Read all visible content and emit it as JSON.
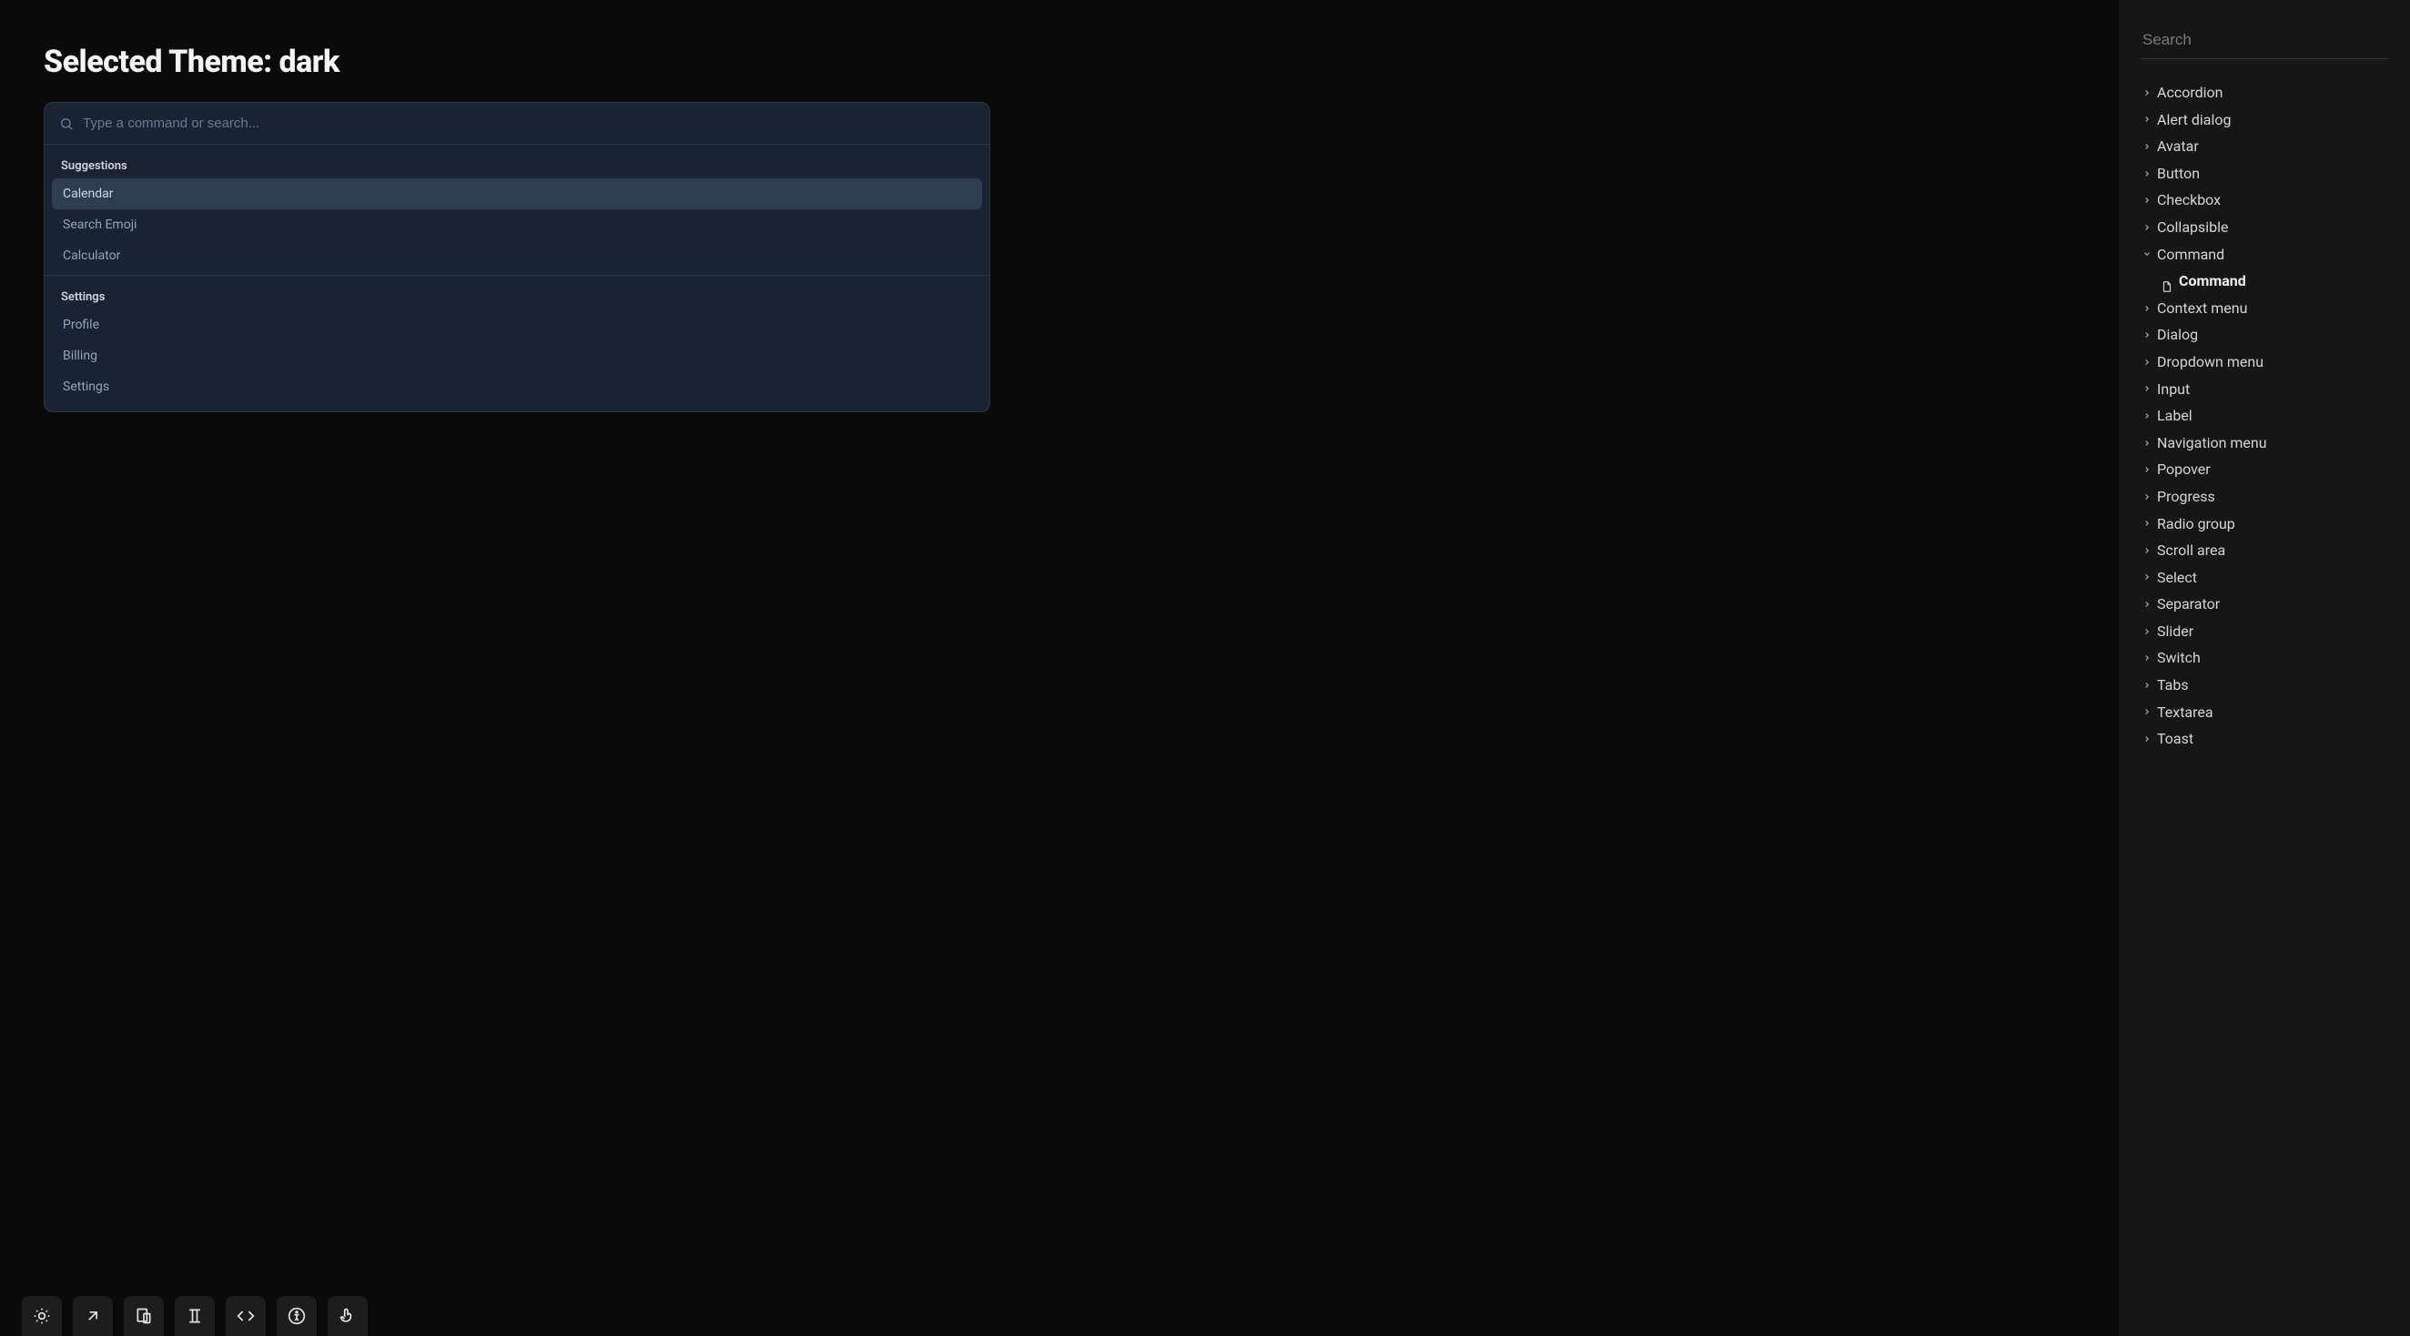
{
  "page": {
    "title": "Selected Theme: dark"
  },
  "command": {
    "placeholder": "Type a command or search...",
    "groups": [
      {
        "heading": "Suggestions",
        "items": [
          {
            "label": "Calendar",
            "selected": true
          },
          {
            "label": "Search Emoji",
            "selected": false
          },
          {
            "label": "Calculator",
            "selected": false
          }
        ]
      },
      {
        "heading": "Settings",
        "items": [
          {
            "label": "Profile",
            "selected": false
          },
          {
            "label": "Billing",
            "selected": false
          },
          {
            "label": "Settings",
            "selected": false
          }
        ]
      }
    ]
  },
  "sidebar": {
    "search_placeholder": "Search",
    "tree": [
      {
        "label": "Accordion",
        "expanded": false
      },
      {
        "label": "Alert dialog",
        "expanded": false
      },
      {
        "label": "Avatar",
        "expanded": false
      },
      {
        "label": "Button",
        "expanded": false
      },
      {
        "label": "Checkbox",
        "expanded": false
      },
      {
        "label": "Collapsible",
        "expanded": false
      },
      {
        "label": "Command",
        "expanded": true,
        "children": [
          {
            "label": "Command"
          }
        ]
      },
      {
        "label": "Context menu",
        "expanded": false
      },
      {
        "label": "Dialog",
        "expanded": false
      },
      {
        "label": "Dropdown menu",
        "expanded": false
      },
      {
        "label": "Input",
        "expanded": false
      },
      {
        "label": "Label",
        "expanded": false
      },
      {
        "label": "Navigation menu",
        "expanded": false
      },
      {
        "label": "Popover",
        "expanded": false
      },
      {
        "label": "Progress",
        "expanded": false
      },
      {
        "label": "Radio group",
        "expanded": false
      },
      {
        "label": "Scroll area",
        "expanded": false
      },
      {
        "label": "Select",
        "expanded": false
      },
      {
        "label": "Separator",
        "expanded": false
      },
      {
        "label": "Slider",
        "expanded": false
      },
      {
        "label": "Switch",
        "expanded": false
      },
      {
        "label": "Tabs",
        "expanded": false
      },
      {
        "label": "Textarea",
        "expanded": false
      },
      {
        "label": "Toast",
        "expanded": false
      }
    ]
  },
  "toolbar": {
    "icons": [
      "theme",
      "fullscreen",
      "responsive",
      "typography",
      "code",
      "accessibility",
      "pointer"
    ]
  }
}
